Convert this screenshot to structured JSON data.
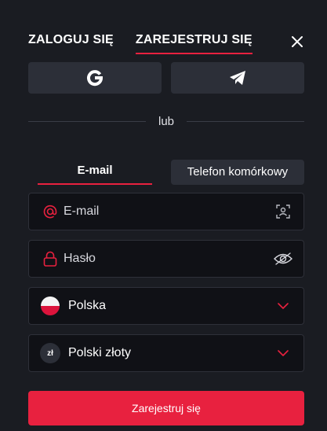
{
  "header": {
    "tabs": [
      {
        "label": "ZALOGUJ SIĘ",
        "active": false
      },
      {
        "label": "ZAREJESTRUJ SIĘ",
        "active": true
      }
    ],
    "close_icon": "close-icon"
  },
  "social": {
    "buttons": [
      {
        "icon": "google-icon"
      },
      {
        "icon": "telegram-icon"
      }
    ]
  },
  "divider": {
    "text": "lub"
  },
  "method": {
    "email_label": "E-mail",
    "phone_label": "Telefon komórkowy",
    "active": "email"
  },
  "form": {
    "email": {
      "placeholder": "E-mail",
      "value": "",
      "lead_icon": "at-icon",
      "trail_icon": "face-scan-icon"
    },
    "password": {
      "placeholder": "Hasło",
      "value": "",
      "lead_icon": "lock-icon",
      "trail_icon": "eye-off-icon"
    },
    "country": {
      "value": "Polska",
      "icon": "poland-flag-icon"
    },
    "currency": {
      "value": "Polski złoty",
      "badge": "zł"
    }
  },
  "submit_label": "Zarejestruj się",
  "colors": {
    "accent": "#e8213f",
    "background": "#1a1c22",
    "surface": "#2c2f38",
    "input_bg": "#101116"
  }
}
